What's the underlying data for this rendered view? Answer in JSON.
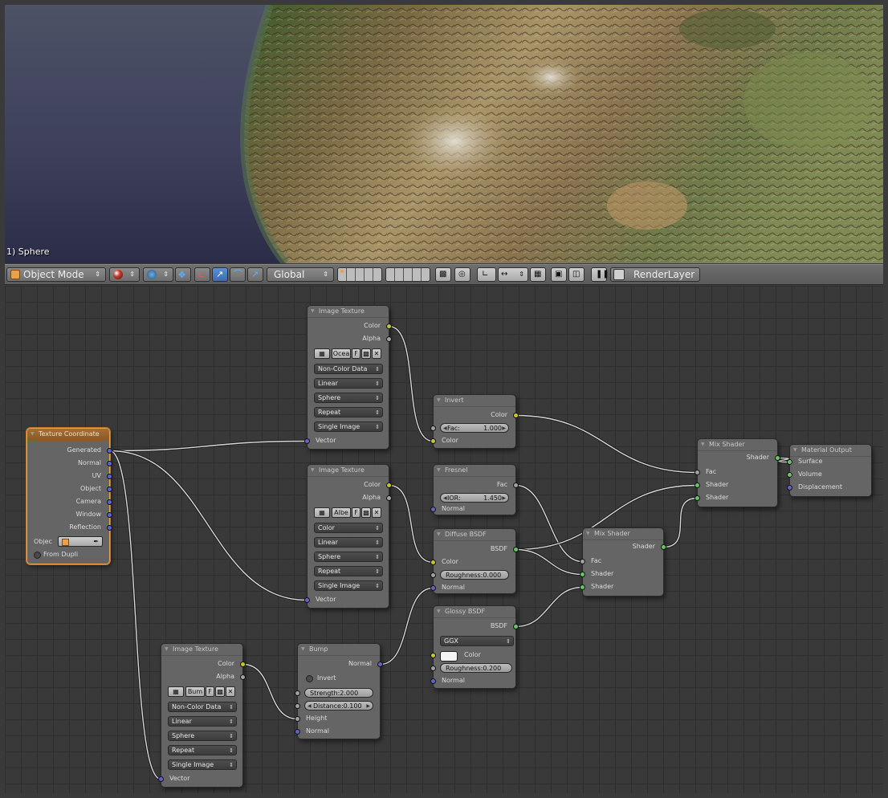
{
  "viewport": {
    "object_label": "1) Sphere"
  },
  "header": {
    "mode": "Object Mode",
    "orientation": "Global",
    "render_layer": "RenderLayer"
  },
  "nodes": {
    "tex_coord": {
      "title": "Texture Coordinate",
      "outputs": [
        "Generated",
        "Normal",
        "UV",
        "Object",
        "Camera",
        "Window",
        "Reflection"
      ],
      "object_label": "Objec",
      "from_dupli": "From Dupli"
    },
    "img_ocean": {
      "title": "Image Texture",
      "outputs": [
        "Color",
        "Alpha"
      ],
      "image_name": "Ocea",
      "fake_user": "F",
      "color_space": "Non-Color Data",
      "interpolation": "Linear",
      "projection": "Sphere",
      "extension": "Repeat",
      "source": "Single Image",
      "input": "Vector"
    },
    "img_albedo": {
      "title": "Image Texture",
      "outputs": [
        "Color",
        "Alpha"
      ],
      "image_name": "Albe",
      "fake_user": "F",
      "color_space": "Color",
      "interpolation": "Linear",
      "projection": "Sphere",
      "extension": "Repeat",
      "source": "Single Image",
      "input": "Vector"
    },
    "img_bump": {
      "title": "Image Texture",
      "outputs": [
        "Color",
        "Alpha"
      ],
      "image_name": "Bum",
      "fake_user": "F",
      "color_space": "Non-Color Data",
      "interpolation": "Linear",
      "projection": "Sphere",
      "extension": "Repeat",
      "source": "Single Image",
      "input": "Vector"
    },
    "invert": {
      "title": "Invert",
      "output": "Color",
      "fac_label": "Fac:",
      "fac_value": "1.000",
      "input": "Color"
    },
    "fresnel": {
      "title": "Fresnel",
      "output": "Fac",
      "ior_label": "IOR:",
      "ior_value": "1.450",
      "input": "Normal"
    },
    "diffuse": {
      "title": "Diffuse BSDF",
      "output": "BSDF",
      "color": "Color",
      "roughness": "Roughness:0.000",
      "normal": "Normal"
    },
    "glossy": {
      "title": "Glossy BSDF",
      "output": "BSDF",
      "distribution": "GGX",
      "color": "Color",
      "roughness": "Roughness:0.200",
      "normal": "Normal"
    },
    "bump": {
      "title": "Bump",
      "output": "Normal",
      "invert": "Invert",
      "strength": "Strength:2.000",
      "distance": "Distance:0.100",
      "height": "Height",
      "normal": "Normal"
    },
    "mix1": {
      "title": "Mix Shader",
      "output": "Shader",
      "inputs": [
        "Fac",
        "Shader",
        "Shader"
      ]
    },
    "mix2": {
      "title": "Mix Shader",
      "output": "Shader",
      "inputs": [
        "Fac",
        "Shader",
        "Shader"
      ]
    },
    "output": {
      "title": "Material Output",
      "inputs": [
        "Surface",
        "Volume",
        "Displacement"
      ]
    }
  },
  "colors": {
    "socket_color": "#c7c729",
    "socket_gray": "#a1a1a1",
    "socket_vector": "#6363c7",
    "socket_shader": "#63c763",
    "selected_node": "#e8a04a",
    "editor_bg": "#393939"
  }
}
